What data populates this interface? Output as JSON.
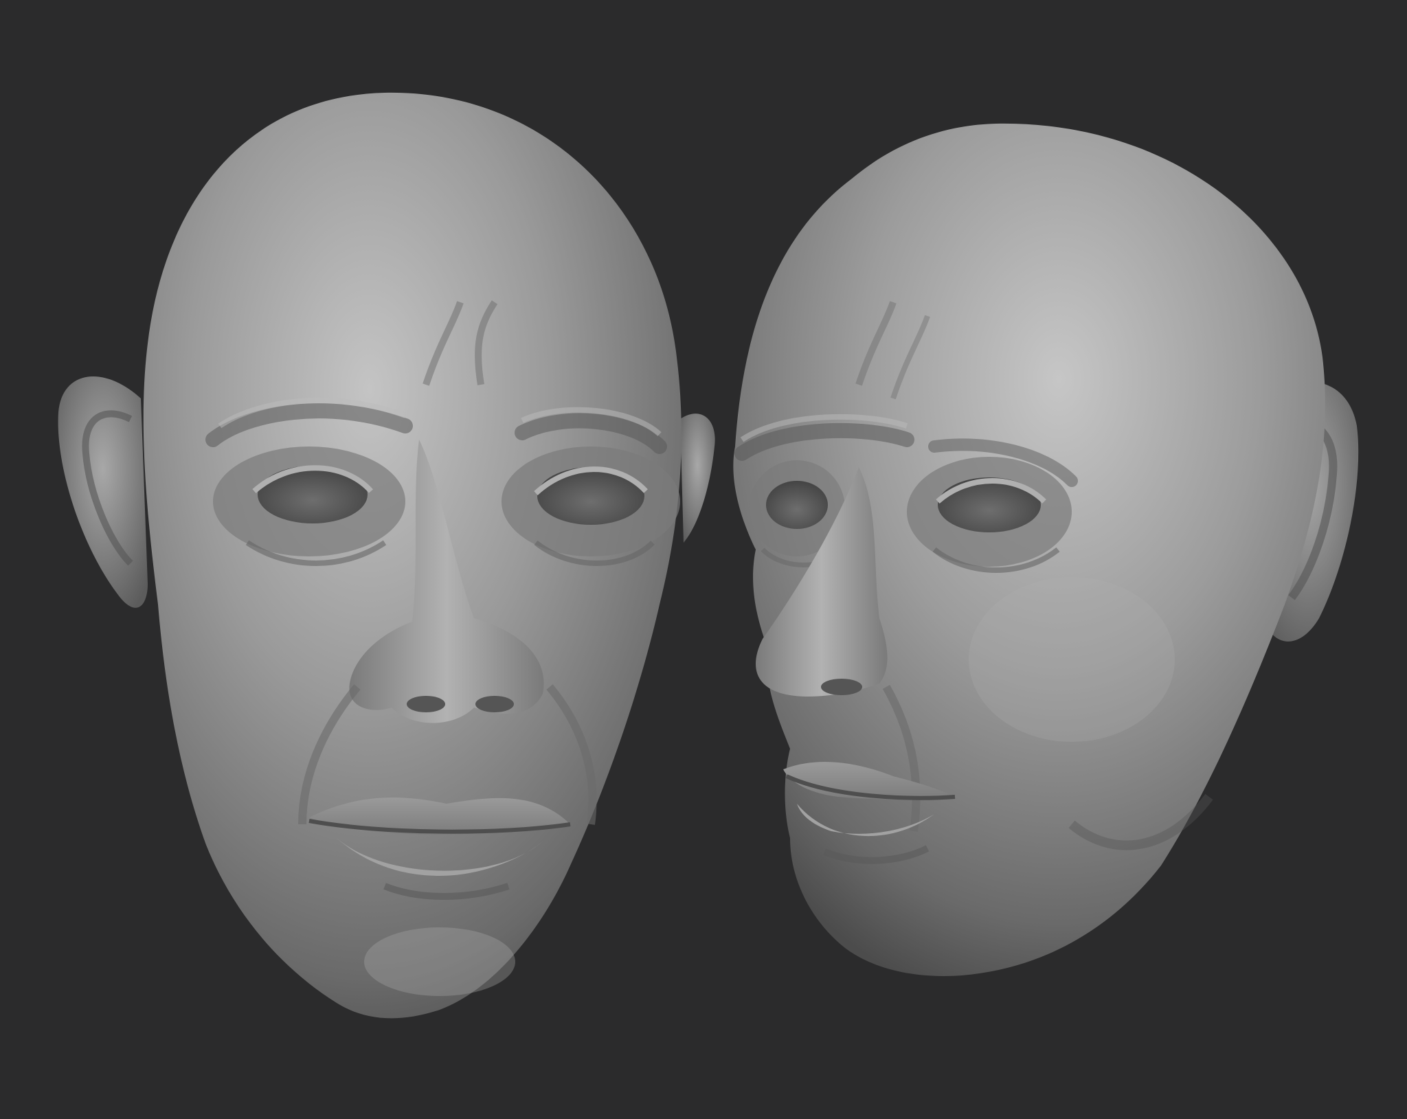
{
  "scene": {
    "background_color": "#2b2b2c",
    "clay_color": "#8a8a8a",
    "models": [
      {
        "name": "head-sculpt",
        "view": "front"
      },
      {
        "name": "head-sculpt",
        "view": "three-quarter"
      }
    ]
  }
}
